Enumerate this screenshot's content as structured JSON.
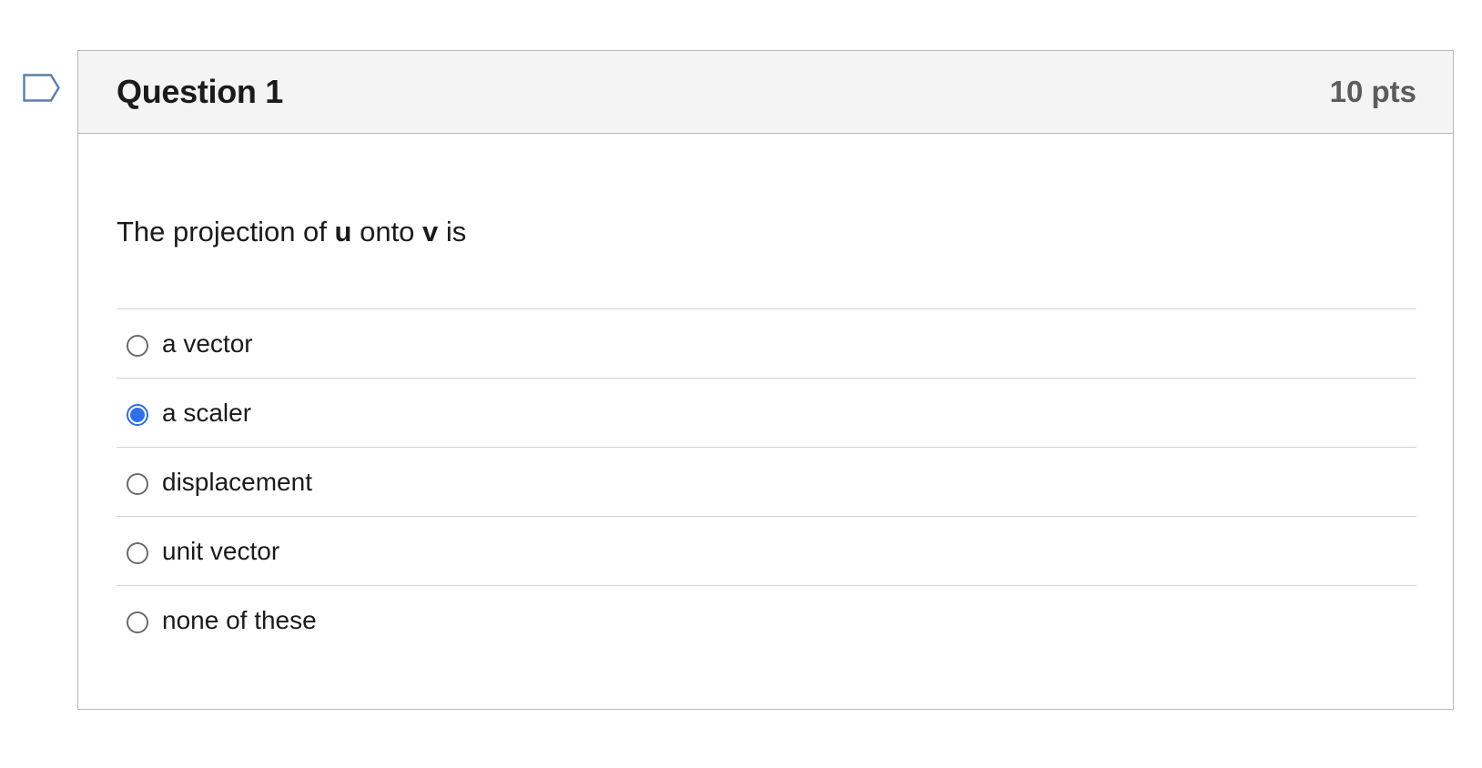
{
  "flag": {
    "icon": "bookmark-flag-icon",
    "color": "#5b7fa6"
  },
  "question": {
    "title": "Question 1",
    "points": "10 pts",
    "text_parts": [
      "The projection of ",
      "u",
      " onto ",
      "v",
      " is"
    ],
    "answers": [
      {
        "label": "a vector",
        "selected": false
      },
      {
        "label": "a scaler",
        "selected": true
      },
      {
        "label": "displacement",
        "selected": false
      },
      {
        "label": "unit vector",
        "selected": false
      },
      {
        "label": "none of these",
        "selected": false
      }
    ]
  },
  "colors": {
    "header_bg": "#f4f4f4",
    "border": "#b8b8b8",
    "radio_selected": "#2f6fe6",
    "points_text": "#5c5c5c"
  }
}
